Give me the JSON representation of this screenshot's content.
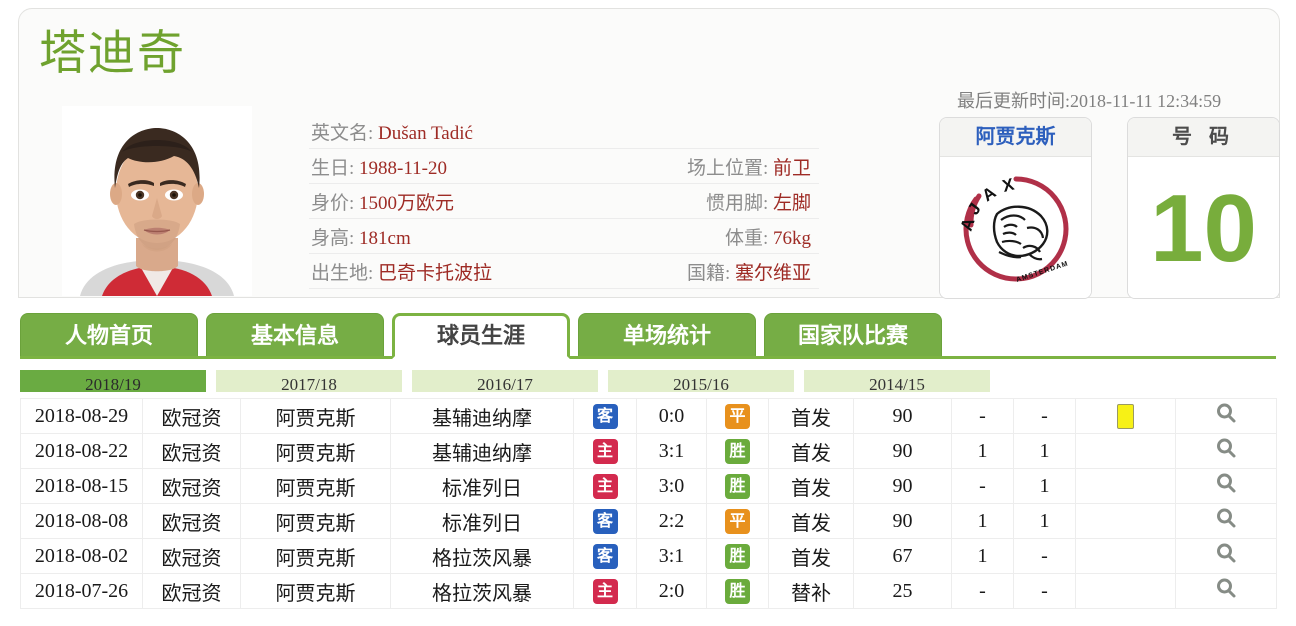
{
  "profile": {
    "player_name": "塔迪奇",
    "photo_alt": "player-photo",
    "info_rows": [
      {
        "left_label": "英文名:",
        "left_value": "Dušan Tadić",
        "right_label": "",
        "right_value": "",
        "full": true
      },
      {
        "left_label": "生日:",
        "left_value": "1988-11-20",
        "right_label": "场上位置:",
        "right_value": "前卫",
        "full": false
      },
      {
        "left_label": "身价:",
        "left_value": "1500万欧元",
        "right_label": "惯用脚:",
        "right_value": "左脚",
        "full": false
      },
      {
        "left_label": "身高:",
        "left_value": "181cm",
        "right_label": "体重:",
        "right_value": "76kg",
        "full": false
      },
      {
        "left_label": "出生地:",
        "left_value": "巴奇卡托波拉",
        "right_label": "国籍:",
        "right_value": "塞尔维亚",
        "full": false
      }
    ],
    "update_time": "最后更新时间:2018-11-11 12:34:59",
    "club_box": {
      "title": "阿贾克斯",
      "logo_name": "ajax-club-logo"
    },
    "number_box": {
      "title": "号 码",
      "value": "10"
    }
  },
  "tabs": [
    {
      "label": "人物首页",
      "active": false
    },
    {
      "label": "基本信息",
      "active": false
    },
    {
      "label": "球员生涯",
      "active": true
    },
    {
      "label": "单场统计",
      "active": false
    },
    {
      "label": "国家队比赛",
      "active": false
    }
  ],
  "seasons": [
    {
      "label": "2018/19",
      "active": true
    },
    {
      "label": "2017/18",
      "active": false
    },
    {
      "label": "2016/17",
      "active": false
    },
    {
      "label": "2015/16",
      "active": false
    },
    {
      "label": "2014/15",
      "active": false
    }
  ],
  "match_table": {
    "rows": [
      {
        "date": "2018-08-29",
        "competition": "欧冠资",
        "team": "阿贾克斯",
        "opponent": "基辅迪纳摩",
        "venue": "客",
        "venue_type": "away",
        "score": "0:0",
        "result": "平",
        "result_type": "draw",
        "start": "首发",
        "minutes": "90",
        "goals": "-",
        "assists": "-",
        "yellow_card": true
      },
      {
        "date": "2018-08-22",
        "competition": "欧冠资",
        "team": "阿贾克斯",
        "opponent": "基辅迪纳摩",
        "venue": "主",
        "venue_type": "home",
        "score": "3:1",
        "result": "胜",
        "result_type": "win",
        "start": "首发",
        "minutes": "90",
        "goals": "1",
        "assists": "1",
        "yellow_card": false
      },
      {
        "date": "2018-08-15",
        "competition": "欧冠资",
        "team": "阿贾克斯",
        "opponent": "标准列日",
        "venue": "主",
        "venue_type": "home",
        "score": "3:0",
        "result": "胜",
        "result_type": "win",
        "start": "首发",
        "minutes": "90",
        "goals": "-",
        "assists": "1",
        "yellow_card": false
      },
      {
        "date": "2018-08-08",
        "competition": "欧冠资",
        "team": "阿贾克斯",
        "opponent": "标准列日",
        "venue": "客",
        "venue_type": "away",
        "score": "2:2",
        "result": "平",
        "result_type": "draw",
        "start": "首发",
        "minutes": "90",
        "goals": "1",
        "assists": "1",
        "yellow_card": false
      },
      {
        "date": "2018-08-02",
        "competition": "欧冠资",
        "team": "阿贾克斯",
        "opponent": "格拉茨风暴",
        "venue": "客",
        "venue_type": "away",
        "score": "3:1",
        "result": "胜",
        "result_type": "win",
        "start": "首发",
        "minutes": "67",
        "goals": "1",
        "assists": "-",
        "yellow_card": false
      },
      {
        "date": "2018-07-26",
        "competition": "欧冠资",
        "team": "阿贾克斯",
        "opponent": "格拉茨风暴",
        "venue": "主",
        "venue_type": "home",
        "score": "2:0",
        "result": "胜",
        "result_type": "win",
        "start": "替补",
        "minutes": "25",
        "goals": "-",
        "assists": "-",
        "yellow_card": false
      }
    ],
    "view_icon": "search-icon"
  },
  "colors": {
    "brand_green": "#76ad45",
    "name_green": "#6fa22e",
    "number_green": "#78ad3c",
    "link_blue": "#3a74c4",
    "value_red": "#9e2b25",
    "home_badge": "#d32a4e",
    "away_badge": "#2860bd",
    "win_badge": "#6aab3c",
    "draw_badge": "#e8911d",
    "yellow_card": "#f7f116"
  }
}
